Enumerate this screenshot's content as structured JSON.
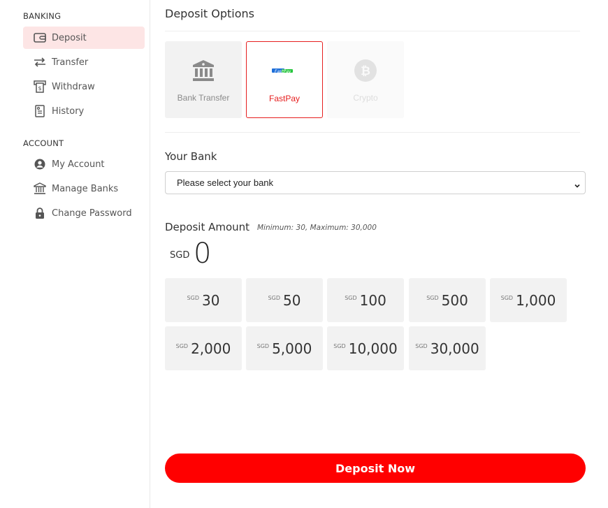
{
  "sidebar": {
    "banking_heading": "BANKING",
    "account_heading": "ACCOUNT",
    "banking_items": [
      {
        "label": "Deposit",
        "icon": "wallet-icon",
        "active": true
      },
      {
        "label": "Transfer",
        "icon": "transfer-arrows-icon"
      },
      {
        "label": "Withdraw",
        "icon": "withdraw-icon"
      },
      {
        "label": "History",
        "icon": "history-icon"
      }
    ],
    "account_items": [
      {
        "label": "My Account",
        "icon": "user-circle-icon"
      },
      {
        "label": "Manage Banks",
        "icon": "bank-icon"
      },
      {
        "label": "Change Password",
        "icon": "lock-icon"
      }
    ]
  },
  "main": {
    "title": "Deposit Options",
    "options": [
      {
        "label": "Bank Transfer",
        "icon": "bank-building-icon",
        "state": "normal"
      },
      {
        "label": "FastPay",
        "icon": "fastpay-logo-icon",
        "state": "selected"
      },
      {
        "label": "Crypto",
        "icon": "bitcoin-icon",
        "state": "disabled"
      }
    ],
    "fastpay_logo_text": "FastPay",
    "bank": {
      "label": "Your Bank",
      "selected": "Please select your bank"
    },
    "amount": {
      "title": "Deposit Amount",
      "limits": "Minimum: 30, Maximum: 30,000",
      "currency": "SGD",
      "value": "0"
    },
    "presets": [
      {
        "currency": "SGD",
        "value": "30"
      },
      {
        "currency": "SGD",
        "value": "50"
      },
      {
        "currency": "SGD",
        "value": "100"
      },
      {
        "currency": "SGD",
        "value": "500"
      },
      {
        "currency": "SGD",
        "value": "1,000"
      },
      {
        "currency": "SGD",
        "value": "2,000"
      },
      {
        "currency": "SGD",
        "value": "5,000"
      },
      {
        "currency": "SGD",
        "value": "10,000"
      },
      {
        "currency": "SGD",
        "value": "30,000"
      }
    ],
    "submit_label": "Deposit Now"
  },
  "colors": {
    "accent": "#ff0000",
    "active_bg": "#fde5e5",
    "card_bg": "#f2f2f2"
  }
}
